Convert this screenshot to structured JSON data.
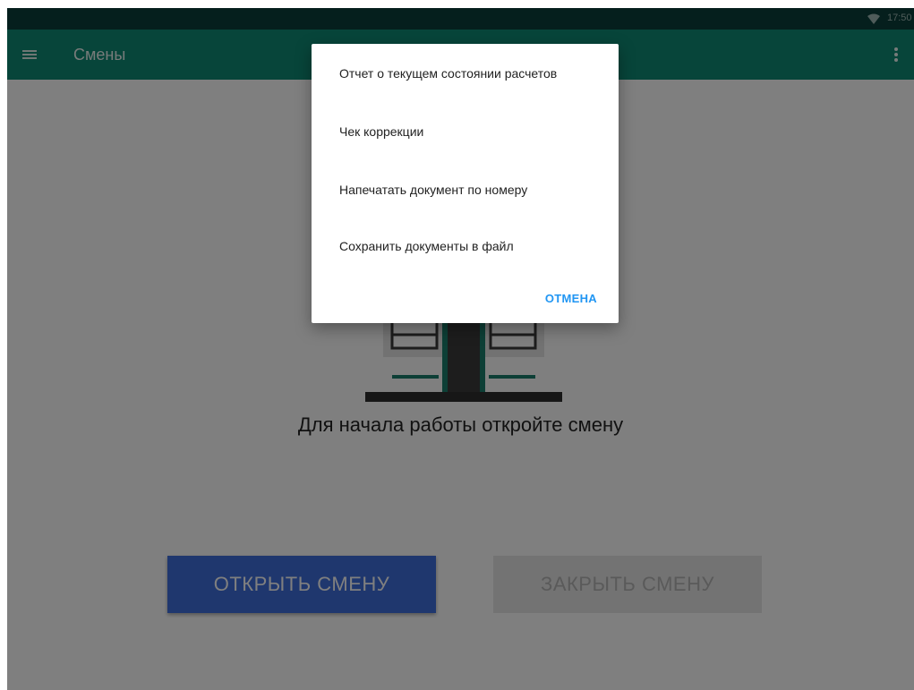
{
  "status_bar": {
    "time": "17:50"
  },
  "app_bar": {
    "title": "Смены"
  },
  "content": {
    "empty_message": "Для начала работы откройте смену",
    "open_button": "ОТКРЫТЬ СМЕНУ",
    "close_button": "ЗАКРЫТЬ СМЕНУ"
  },
  "dialog": {
    "items": [
      "Отчет о текущем состоянии расчетов",
      "Чек коррекции",
      "Напечатать документ по номеру",
      "Сохранить документы в файл"
    ],
    "cancel": "ОТМЕНА"
  },
  "colors": {
    "app_bar": "#0f8b74",
    "status_bar": "#0b3f3a",
    "primary_button": "#3f6edd",
    "dialog_action": "#2196f3"
  }
}
